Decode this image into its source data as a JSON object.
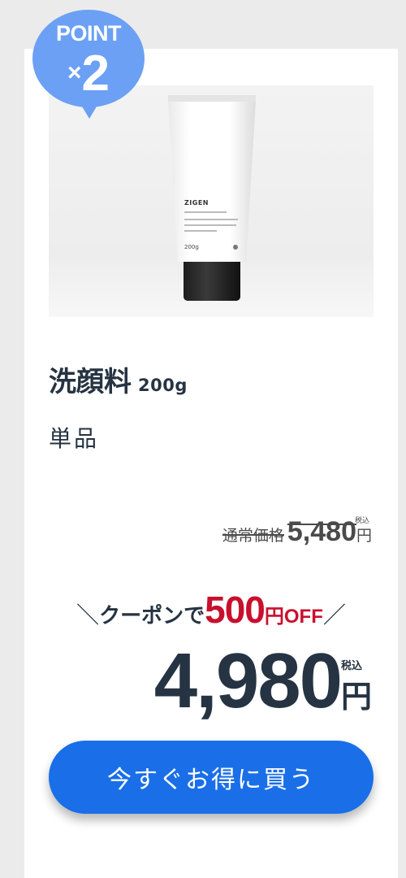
{
  "badge": {
    "label": "POINT",
    "multiplier_symbol": "×",
    "multiplier_value": "2",
    "color": "#6ba0f4"
  },
  "product": {
    "tube_brand": "ZIGEN",
    "tube_weight": "200g",
    "name": "洗顔料",
    "size": "200g",
    "type": "単品"
  },
  "pricing": {
    "regular_label": "通常価格",
    "regular_value": "5,480",
    "regular_unit": "円",
    "regular_tax": "税込",
    "coupon_prefix": "＼",
    "coupon_text": "クーポンで",
    "coupon_amount": "500",
    "coupon_unit": "円",
    "coupon_off": "OFF",
    "coupon_suffix": "／",
    "sale_value": "4,980",
    "sale_unit": "円",
    "sale_tax": "税込",
    "accent_color": "#c8102e"
  },
  "cta": {
    "label": "今すぐお得に買う",
    "color": "#1a6fe8"
  }
}
